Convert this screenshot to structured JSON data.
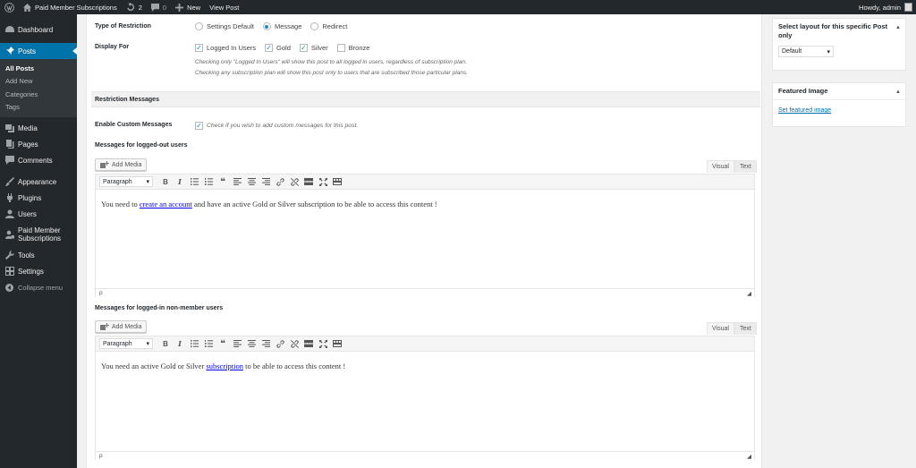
{
  "admin_bar": {
    "site_name": "Paid Member Subscriptions",
    "updates_count": "2",
    "comments_count": "0",
    "new_label": "New",
    "view_post_label": "View Post",
    "howdy": "Howdy, admin"
  },
  "menu": {
    "dashboard": "Dashboard",
    "posts": "Posts",
    "posts_sub": [
      "All Posts",
      "Add New",
      "Categories",
      "Tags"
    ],
    "media": "Media",
    "pages": "Pages",
    "comments": "Comments",
    "appearance": "Appearance",
    "plugins": "Plugins",
    "users": "Users",
    "pms_line1": "Paid Member",
    "pms_line2": "Subscriptions",
    "tools": "Tools",
    "settings": "Settings",
    "collapse": "Collapse menu"
  },
  "restriction": {
    "type_label": "Type of Restriction",
    "type_options": [
      "Settings Default",
      "Message",
      "Redirect"
    ],
    "type_selected": "Message",
    "display_for_label": "Display For",
    "display_options": [
      "Logged In Users",
      "Gold",
      "Silver",
      "Bronze"
    ],
    "help1": "Checking only \"Logged In Users\" will show this post to all logged in users, regardless of subscription plan.",
    "help2": "Checking any subscription plan will show this post only to users that are subscribed those particular plans."
  },
  "messages": {
    "section_title": "Restriction Messages",
    "enable_label": "Enable Custom Messages",
    "enable_text": "Check if you wish to add custom messages for this post.",
    "logged_out_label": "Messages for logged-out users",
    "logged_in_label": "Messages for logged-in non-member users",
    "add_media": "Add Media",
    "tab_visual": "Visual",
    "tab_text": "Text",
    "format": "Paragraph",
    "status_p": "p",
    "msg1_before": "You need to",
    "msg1_link": "create an account",
    "msg1_after": "and have an active Gold or Silver subscription to be able to access this content !",
    "msg2_before": "You need an active Gold or Silver",
    "msg2_link": "subscription",
    "msg2_after": "to be able to access this content !"
  },
  "sidebar": {
    "layout_title": "Select layout for this specific Post only",
    "layout_value": "Default",
    "featured_title": "Featured Image",
    "featured_link": "Set featured image"
  },
  "colors": {
    "accent": "#0073aa",
    "menu_bg": "#23282d",
    "check": "#1e8cbe"
  }
}
